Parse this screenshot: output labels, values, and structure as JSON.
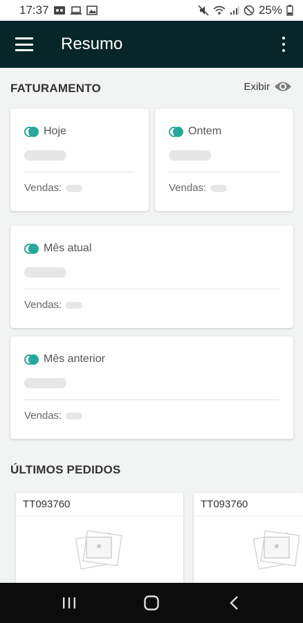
{
  "status_bar": {
    "time": "17:37",
    "battery": "25%",
    "left_icons": [
      "voicemail-icon",
      "laptop-icon",
      "image-icon"
    ],
    "right_icons": [
      "mute-icon",
      "wifi-icon",
      "signal-icon",
      "no-disturb-icon",
      "battery-icon"
    ]
  },
  "app_bar": {
    "title": "Resumo",
    "menu_icon": "hamburger-menu-icon",
    "overflow_icon": "more-vertical-icon"
  },
  "billing": {
    "section_title": "FATURAMENTO",
    "show_label": "Exibir",
    "show_icon": "eye-icon",
    "accent_color": "#27a89a",
    "cards": [
      {
        "label": "Hoje",
        "sales_label": "Vendas:"
      },
      {
        "label": "Ontem",
        "sales_label": "Vendas:"
      },
      {
        "label": "Mês atual",
        "sales_label": "Vendas:"
      },
      {
        "label": "Mês anterior",
        "sales_label": "Vendas:"
      }
    ]
  },
  "orders": {
    "section_title": "ÚLTIMOS PEDIDOS",
    "items": [
      {
        "id": "TT093760",
        "image_icon": "product-placeholder-icon"
      },
      {
        "id": "TT093760",
        "image_icon": "product-placeholder-icon"
      }
    ]
  },
  "nav_bar": {
    "icons": [
      "recent-apps-icon",
      "home-icon",
      "back-icon"
    ]
  },
  "colors": {
    "app_bar": "#072629",
    "background": "#f2f3f3",
    "accent": "#27a89a"
  }
}
